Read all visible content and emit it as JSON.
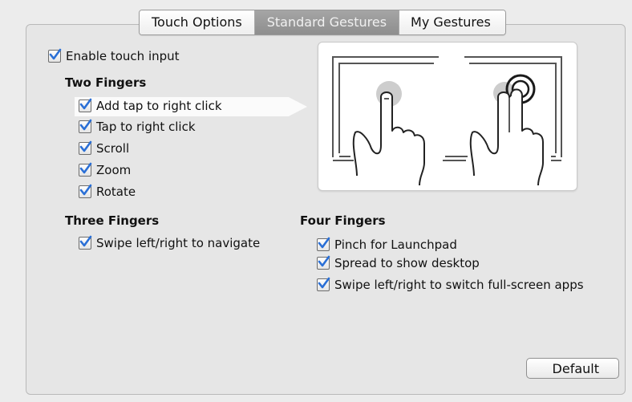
{
  "tabs": [
    {
      "label": "Touch Options",
      "selected": false
    },
    {
      "label": "Standard Gestures",
      "selected": true
    },
    {
      "label": "My Gestures",
      "selected": false
    }
  ],
  "enable_touch": {
    "label": "Enable touch input",
    "checked": true
  },
  "two_fingers": {
    "heading": "Two Fingers",
    "options": [
      {
        "label": "Add tap to right click",
        "checked": true,
        "highlighted": true
      },
      {
        "label": "Tap to right click",
        "checked": true
      },
      {
        "label": "Scroll",
        "checked": true
      },
      {
        "label": "Zoom",
        "checked": true
      },
      {
        "label": "Rotate",
        "checked": true
      }
    ]
  },
  "three_fingers": {
    "heading": "Three Fingers",
    "options": [
      {
        "label": "Swipe left/right to navigate",
        "checked": true
      }
    ]
  },
  "four_fingers": {
    "heading": "Four Fingers",
    "options": [
      {
        "label": "Pinch for Launchpad",
        "checked": true
      },
      {
        "label": "Spread to show desktop",
        "checked": true
      },
      {
        "label": "Swipe left/right to switch full-screen apps",
        "checked": true
      }
    ]
  },
  "preview": {
    "icon": "two-finger-tap-gesture-illustration"
  },
  "default_button": {
    "label": "Default"
  },
  "colors": {
    "checkmark": "#2a6fd6",
    "active_tab": "#9c9c9c",
    "pane": "#e6e6e6"
  }
}
